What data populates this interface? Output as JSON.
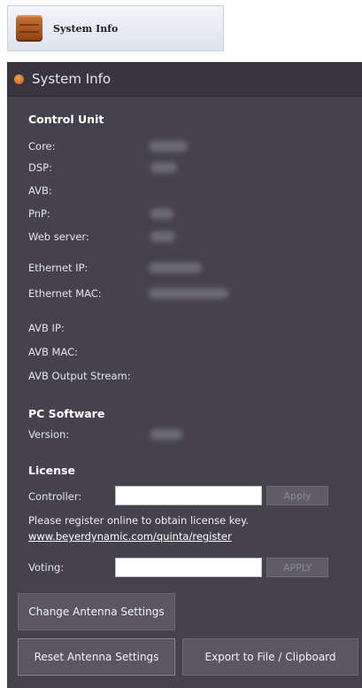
{
  "launcher": {
    "label": "System Info",
    "icon": "cabinet-icon"
  },
  "window": {
    "title": "System Info",
    "icon": "orange-dot-icon"
  },
  "control_unit": {
    "heading": "Control Unit",
    "rows": [
      {
        "label": "Core:"
      },
      {
        "label": "DSP:"
      },
      {
        "label": "AVB:"
      },
      {
        "label": "PnP:"
      },
      {
        "label": "Web server:"
      },
      {
        "label": "Ethernet IP:"
      },
      {
        "label": "Ethernet MAC:"
      },
      {
        "label": "AVB IP:"
      },
      {
        "label": "AVB MAC:"
      },
      {
        "label": "AVB Output Stream:"
      }
    ]
  },
  "pc_software": {
    "heading": "PC Software",
    "version_label": "Version:"
  },
  "license": {
    "heading": "License",
    "controller_label": "Controller:",
    "controller_value": "",
    "controller_apply": "Apply",
    "register_text": "Please register online to obtain license key.",
    "register_link": "www.beyerdynamic.com/quinta/register",
    "voting_label": "Voting:",
    "voting_value": "",
    "voting_apply": "APPLY"
  },
  "buttons": {
    "change_antenna": "Change Antenna Settings",
    "reset_antenna": "Reset Antenna Settings",
    "export": "Export to File / Clipboard"
  }
}
